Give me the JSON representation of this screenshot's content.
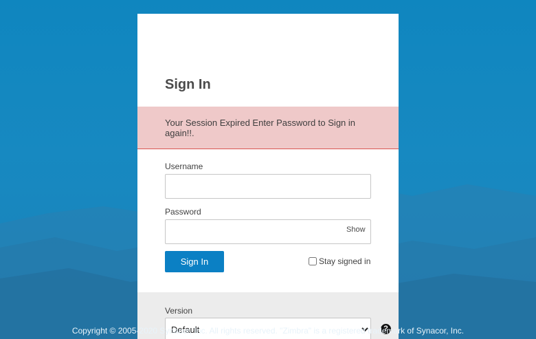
{
  "login": {
    "title": "Sign In",
    "alert_message": "Your Session Expired Enter Password to Sign in again!!.",
    "username_label": "Username",
    "username_value": "",
    "password_label": "Password",
    "password_value": "",
    "show_label": "Show",
    "sign_in_button": "Sign In",
    "stay_signed_in_label": "Stay signed in",
    "stay_signed_in_checked": false,
    "version_label": "Version",
    "version_selected": "Default"
  },
  "footer": {
    "copyright": "Copyright © 2005-2020 Synacor, Inc. All rights reserved. \"Zimbra\" is a registered trademark of Synacor, Inc."
  },
  "colors": {
    "background": "#1789c1",
    "primary_button": "#0b80c4",
    "alert_background": "#efc9c9",
    "alert_border": "#d9534f"
  },
  "icons": {
    "help": "help-circle-icon"
  }
}
